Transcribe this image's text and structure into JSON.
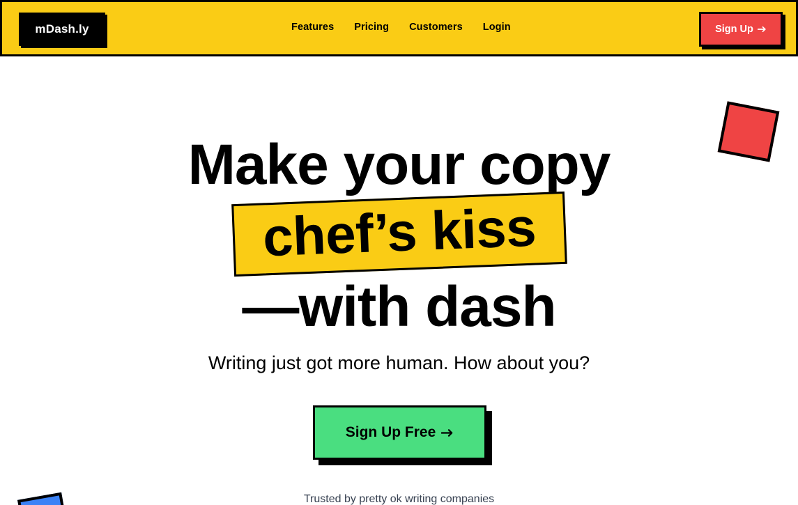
{
  "header": {
    "logo": "mDash.ly",
    "nav": [
      "Features",
      "Pricing",
      "Customers",
      "Login"
    ],
    "signup_label": "Sign Up",
    "signup_icon": "arrow-right-icon"
  },
  "hero": {
    "headline_line1": "Make your copy",
    "headline_line2": "chef’s kiss",
    "headline_line3": "—with dash",
    "subtitle": "Writing just got more human. How about you?",
    "cta_label": "Sign Up Free",
    "cta_icon": "arrow-right-icon",
    "trusted_text": "Trusted by pretty ok writing companies"
  },
  "colors": {
    "brand_yellow": "#facc15",
    "accent_red": "#ef4444",
    "cta_green": "#4ade80",
    "deco_blue": "#3b82f6",
    "ink": "#000000"
  }
}
